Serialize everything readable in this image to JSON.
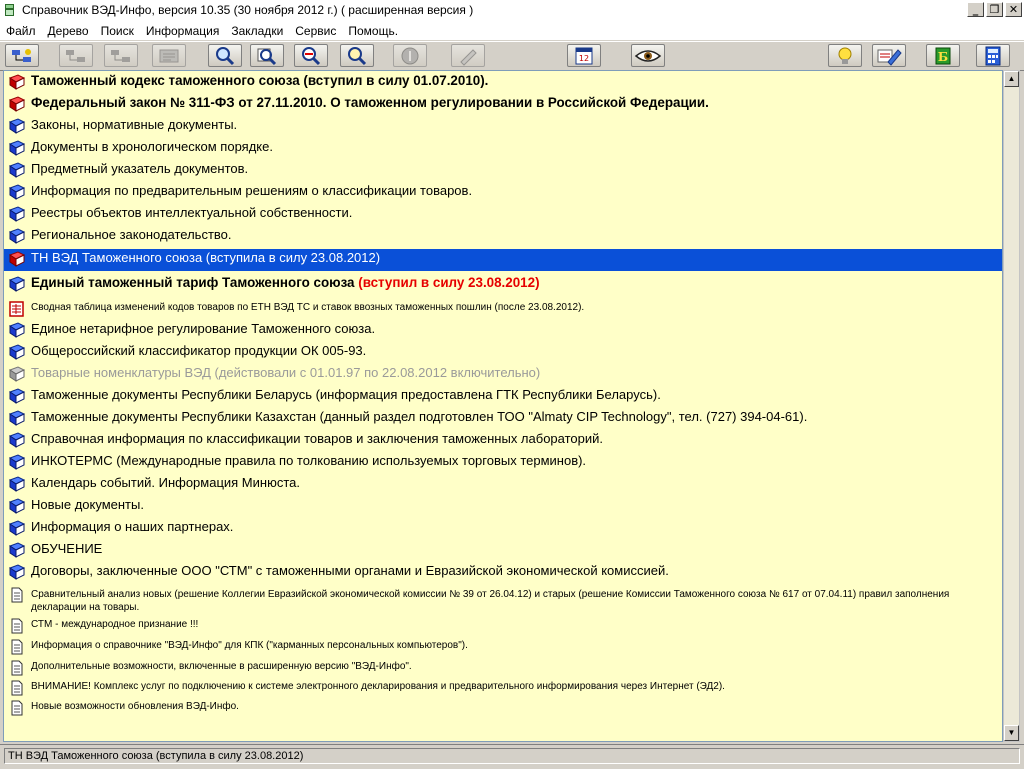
{
  "window": {
    "title": "Справочник ВЭД-Инфо, версия 10.35 (30 ноября 2012 г.)  ( расширенная версия )",
    "minimize": "_",
    "restore": "❐",
    "close": "✕"
  },
  "menu": [
    "Файл",
    "Дерево",
    "Поиск",
    "Информация",
    "Закладки",
    "Сервис",
    "Помощь."
  ],
  "toolbar": {
    "buttons": [
      {
        "icon": "tree-expand-icon",
        "enabled": true
      },
      {
        "icon": "tree-collapse-icon",
        "enabled": false
      },
      {
        "icon": "tree-level-icon",
        "enabled": false
      },
      {
        "icon": "document-info-icon",
        "enabled": false
      },
      {
        "icon": "search-icon",
        "enabled": true
      },
      {
        "icon": "search-document-icon",
        "enabled": true
      },
      {
        "icon": "search-code-icon",
        "enabled": true
      },
      {
        "icon": "search-link-icon",
        "enabled": true
      },
      {
        "icon": "info-icon",
        "enabled": false
      },
      {
        "icon": "edit-note-icon",
        "enabled": false
      },
      {
        "icon": "calendar-icon",
        "enabled": true
      },
      {
        "icon": "eye-icon",
        "enabled": true
      },
      {
        "icon": "lightbulb-icon",
        "enabled": true
      },
      {
        "icon": "notes-pencil-icon",
        "enabled": true
      },
      {
        "icon": "book-b-icon",
        "enabled": true
      },
      {
        "icon": "calculator-icon",
        "enabled": true
      }
    ],
    "calendar_day": "12"
  },
  "colors": {
    "tree_background": "#ffffc8",
    "selection": "#0a50d8",
    "highlight_red": "#e60000",
    "disabled_gray": "#9a9a9a"
  },
  "tree": [
    {
      "icon": "red-book-icon",
      "text": "Таможенный кодекс таможенного союза (вступил в силу 01.07.2010).",
      "style": "big"
    },
    {
      "icon": "red-book-icon",
      "text": "Федеральный закон № 311-ФЗ от 27.11.2010. О таможенном регулировании в Российской Федерации.",
      "style": "big"
    },
    {
      "icon": "blue-book-icon",
      "text": "Законы, нормативные документы.",
      "style": "normal"
    },
    {
      "icon": "blue-book-icon",
      "text": "Документы в хронологическом порядке.",
      "style": "normal"
    },
    {
      "icon": "blue-book-icon",
      "text": "Предметный указатель документов.",
      "style": "normal"
    },
    {
      "icon": "blue-book-icon",
      "text": "Информация по предварительным решениям о классификации товаров.",
      "style": "normal"
    },
    {
      "icon": "blue-book-icon",
      "text": "Реестры объектов интеллектуальной собственности.",
      "style": "normal"
    },
    {
      "icon": "blue-book-icon",
      "text": "Региональное законодательство.",
      "style": "normal"
    },
    {
      "icon": "red-book-icon",
      "text": "ТН ВЭД Таможенного союза (вступила в силу 23.08.2012)",
      "style": "selected"
    },
    {
      "icon": "blue-book-icon",
      "text": "Единый таможенный тариф Таможенного союза",
      "extra": "(вступил в силу 23.08.2012)",
      "style": "big"
    },
    {
      "icon": "table-changes-icon",
      "text": "Сводная таблица изменений кодов товаров по ЕТН ВЭД ТС и ставок ввозных таможенных пошлин (после 23.08.2012).",
      "style": "small-red"
    },
    {
      "icon": "blue-book-icon",
      "text": "Единое нетарифное регулирование Таможенного союза.",
      "style": "normal"
    },
    {
      "icon": "blue-book-icon",
      "text": "Общероссийский классификатор продукции ОК 005-93.",
      "style": "normal"
    },
    {
      "icon": "gray-book-icon",
      "text": "Товарные номенклатуры ВЭД (действовали с 01.01.97 по 22.08.2012 включительно)",
      "style": "gray"
    },
    {
      "icon": "blue-book-icon",
      "text": "Таможенные документы Республики Беларусь (информация предоставлена ГТК Республики Беларусь).",
      "style": "normal"
    },
    {
      "icon": "blue-book-icon",
      "text": "Таможенные документы Республики Казахстан (данный раздел подготовлен ТОО \"Almaty CIP Technology\", тел. (727) 394-04-61).",
      "style": "normal"
    },
    {
      "icon": "blue-book-icon",
      "text": "Справочная информация по классификации товаров и заключения таможенных лабораторий.",
      "style": "normal"
    },
    {
      "icon": "blue-book-icon",
      "text": "ИНКОТЕРМС (Международные правила по толкованию используемых торговых терминов).",
      "style": "normal"
    },
    {
      "icon": "blue-book-icon",
      "text": "Календарь событий. Информация Минюста.",
      "style": "normal"
    },
    {
      "icon": "blue-book-icon",
      "text": "Новые документы.",
      "style": "normal"
    },
    {
      "icon": "blue-book-icon",
      "text": "Информация о наших партнерах.",
      "style": "normal"
    },
    {
      "icon": "blue-book-icon",
      "text": "ОБУЧЕНИЕ",
      "style": "normal"
    },
    {
      "icon": "blue-book-icon",
      "text": "Договоры, заключенные ООО \"СТМ\" с таможенными органами и Евразийской экономической комиссией.",
      "style": "normal"
    },
    {
      "icon": "document-icon",
      "text": "Сравнительный анализ новых (решение Коллегии Евразийской экономической комиссии № 39 от 26.04.12) и старых (решение Комиссии Таможенного союза № 617 от 07.04.11) правил заполнения декларации на товары.",
      "style": "small-wrap"
    },
    {
      "icon": "document-icon",
      "text": "СТМ - международное признание !!!",
      "style": "small"
    },
    {
      "icon": "document-icon",
      "text": "Информация о справочнике \"ВЭД-Инфо\" для КПК (\"карманных персональных компьютеров\").",
      "style": "small"
    },
    {
      "icon": "document-icon",
      "text": "Дополнительные возможности, включенные в расширенную версию \"ВЭД-Инфо\".",
      "style": "small"
    },
    {
      "icon": "document-icon",
      "text": "ВНИМАНИЕ! Комплекс услуг по подключению к системе электронного декларирования и предварительного информирования через Интернет (ЭД2).",
      "style": "small"
    },
    {
      "icon": "document-icon",
      "text": "Новые возможности обновления ВЭД-Инфо.",
      "style": "small"
    }
  ],
  "scrollbar": {
    "up": "▲",
    "down": "▼"
  },
  "status": {
    "text": "ТН ВЭД Таможенного союза (вступила в силу 23.08.2012)"
  }
}
